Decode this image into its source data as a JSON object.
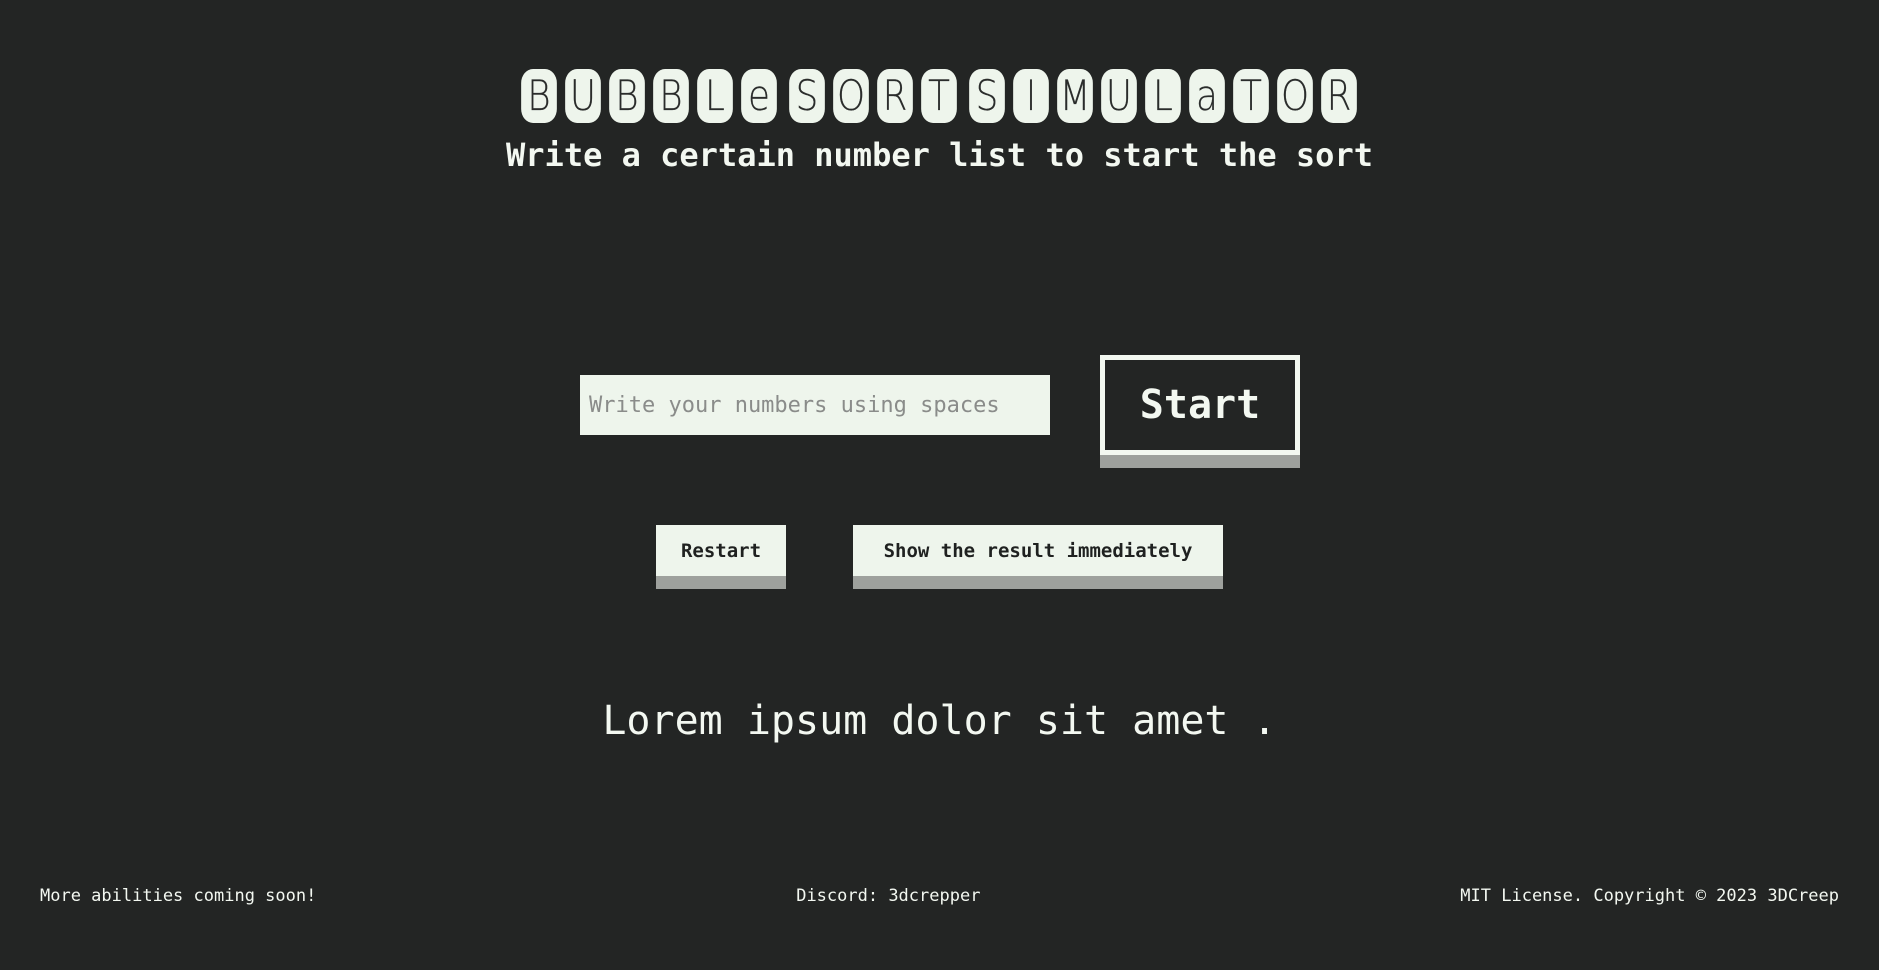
{
  "title": {
    "words": [
      [
        "B",
        "U",
        "B",
        "B",
        "L",
        "e"
      ],
      [
        "S",
        "O",
        "R",
        "T"
      ],
      [
        "S",
        "I",
        "M",
        "U",
        "L",
        "a",
        "T",
        "O",
        "R"
      ]
    ]
  },
  "subtitle": "Write a certain number list to start the sort",
  "input": {
    "placeholder": "Write your numbers using spaces",
    "value": ""
  },
  "buttons": {
    "start": "Start",
    "restart": "Restart",
    "show_result": "Show the result immediately"
  },
  "output_text": "Lorem ipsum dolor sit amet .",
  "footer": {
    "left": "More abilities coming soon!",
    "center": "Discord: 3dcrepper",
    "right": "MIT License. Copyright © 2023 3DCreep"
  },
  "colors": {
    "background": "#232524",
    "light": "#eef5ec",
    "shadow": "#9ea19d"
  }
}
